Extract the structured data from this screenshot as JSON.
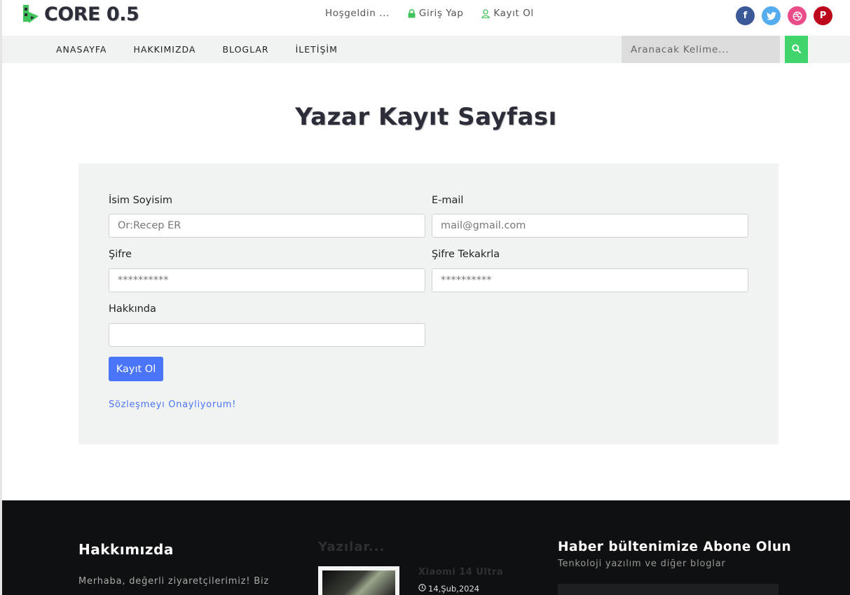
{
  "brand": {
    "name": "CORE 0.5",
    "mark_colors": [
      "#41c35c",
      "#2b2e38"
    ]
  },
  "top_links": {
    "welcome": "Hoşgeldin ...",
    "login": "Giriş Yap",
    "register": "Kayıt Ol"
  },
  "socials": [
    {
      "name": "facebook",
      "glyph": "f",
      "color": "#3b5998"
    },
    {
      "name": "twitter",
      "color": "#55acee"
    },
    {
      "name": "dribbble",
      "color": "#ea4c89"
    },
    {
      "name": "pinterest",
      "glyph": "P",
      "color": "#bd081c"
    }
  ],
  "nav": {
    "items": [
      "ANASAYFA",
      "HAKKIMIZDA",
      "BLOGLAR",
      "İLETİŞİM"
    ]
  },
  "search": {
    "placeholder": "Aranacak Kelime..."
  },
  "page": {
    "title": "Yazar Kayıt Sayfası"
  },
  "form": {
    "name_label": "İsim Soyisim",
    "name_placeholder": "Ör:Recep ER",
    "email_label": "E-mail",
    "email_placeholder": "mail@gmail.com",
    "password_label": "Şifre",
    "password_placeholder": "**********",
    "password_repeat_label": "Şifre Tekakrla",
    "password_repeat_placeholder": "**********",
    "about_label": "Hakkında",
    "submit_label": "Kayıt Ol",
    "agreement_label": "Sözleşmeyı Onayliyorum!"
  },
  "footer": {
    "about_title": "Hakkımızda",
    "about_text": "Merhaba, değerli ziyaretçilerimiz! Biz",
    "posts_title": "Yazılar...",
    "post": {
      "title": "Xiaomi 14 Ultra",
      "date": "14,Şub,2024"
    },
    "newsletter_title": "Haber bültenimize Abone Olun",
    "newsletter_sub": "Tenkoloji yazılım ve diğer bloglar"
  },
  "colors": {
    "accent_green": "#41d46a",
    "primary_blue": "#4a75f8",
    "footer_bg": "#0f1011"
  }
}
